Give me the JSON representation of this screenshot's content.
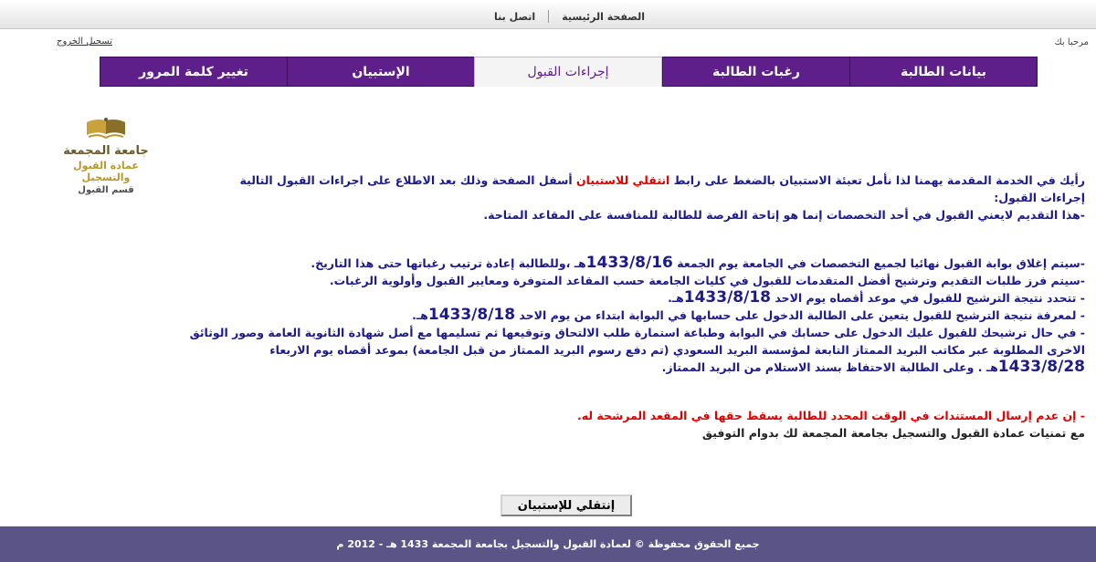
{
  "topnav": {
    "home": "الصفحة الرئيسية",
    "contact": "اتصل بنا"
  },
  "header": {
    "welcome": "مرحبا بك",
    "logout": "تسجيل الخروج"
  },
  "tabs": [
    {
      "label": "بيانات الطالبة"
    },
    {
      "label": "رغبات الطالبة"
    },
    {
      "label": "إجراءات القبول"
    },
    {
      "label": "الإستبيان"
    },
    {
      "label": "تغيير كلمة المرور"
    }
  ],
  "logo": {
    "line1": "جامعة المجمعة",
    "line2": "عمادة القبول والتسجيل",
    "line3": "قسم القبول"
  },
  "content": {
    "intro_a": "رأيك في الخدمة المقدمة يهمنا لذا نأمل تعبئة الاستبيان بالضغط على  رابط ",
    "intro_link": "انتقلي للاستبيان",
    "intro_b": " أسفل الصفحة وذلك بعد الاطلاع على اجراءات القبول التالية",
    "heading": "إجراءات القبول:",
    "p1": "-هذا التقديم لايعني القبول في أحد التخصصات إنما هو إتاحة الفرصة للطالبة للمنافسة على المقاعد المتاحة.",
    "p2_a": "-سيتم إغلاق بوابة القبول نهائيا لجميع التخصصات في الجامعة يوم الجمعة ",
    "p2_date": "1433/8/16",
    "p2_b": "هـ ،وللطالبة إعادة ترتيب رغباتها حتى هذا التاريخ.",
    "p3": "-سيتم فرز طلبات التقديم وترشيح أفضل المتقدمات للقبول في كليات الجامعة حسب المقاعد المتوفرة ومعايير القبول وأولوية الرغبات.",
    "p4_a": "- تتحدد نتيجة الترشيح للقبول في موعد أقصاه يوم الاحد ",
    "p4_date": "1433/8/18",
    "p4_b": "هـ.",
    "p5_a": "- لمعرفة نتيجة الترشيح للقبول يتعين على الطالبة الدخول على حسابها في البوابة ابتداء من يوم الاحد ",
    "p5_date": "1433/8/18",
    "p5_b": "هـ.",
    "p6_a": "- في حال ترشيحك للقبول عليك الدخول على حسابك في البوابة وطباعة استمارة طلب الالتحاق وتوقيعها ثم تسليمها مع أصل شهادة الثانوية العامة وصور الوثائق الاخرى المطلوبة عبر مكاتب البريد الممتاز التابعة لمؤسسة البريد السعودي (تم دفع رسوم البريد الممتاز من قبل الجامعة) بموعد أقصاه يوم الاربعاء ",
    "p6_date": "1433/8/28",
    "p6_b": "هـ . وعلى الطالبة الاحتفاظ بسند الاستلام من البريد الممتاز.",
    "warning": "- إن عدم إرسال المستندات في الوقت المحدد للطالبة يسقط حقها في المقعد المرشحة له.",
    "closing": "مع تمنيات عمادة القبول والتسجيل بجامعة المجمعة  لك بدوام التوفيق"
  },
  "survey_button": "إنتقلي للإستبيان",
  "footer": "جميع الحقوق محفوظة © لعمادة القبول والتسجيل بجامعة المجمعة 1433 هـ  -  2012 م",
  "colors": {
    "tab_purple": "#5e1f8a",
    "footer": "#5b5487",
    "body_text": "#1d1a8c",
    "warning": "#e10000"
  }
}
